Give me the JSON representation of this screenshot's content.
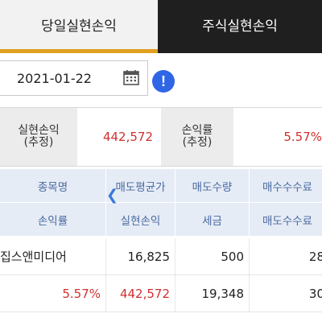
{
  "tabs": [
    {
      "label": "당일실현손익",
      "active": true
    },
    {
      "label": "주식실현손익",
      "active": false
    }
  ],
  "date_picker": {
    "value": "2021-01-22",
    "icon": "calendar-icon"
  },
  "info_button": {
    "label": "!",
    "icon": "info-icon"
  },
  "summary": {
    "realized_pnl": {
      "label": "실현손익\n(추정)",
      "value": "442,572"
    },
    "return_rate": {
      "label": "손익률\n(추정)",
      "value": "5.57%"
    }
  },
  "table": {
    "header_row1": [
      "종목명",
      "매도평균가",
      "매도수량",
      "매수수수료"
    ],
    "header_row2": [
      "손익률",
      "실현손익",
      "세금",
      "매도수수료"
    ],
    "rows": [
      {
        "line1": [
          "집스앤미디어",
          "16,825",
          "500",
          "28"
        ],
        "line2": [
          "5.57%",
          "442,572",
          "19,348",
          "30"
        ]
      }
    ]
  },
  "colors": {
    "accent": "#e0a020",
    "tab_dark": "#1f1f1f",
    "profit_red": "#d03030",
    "header_blue": "#e6ecf6",
    "info_blue": "#2f66e6"
  }
}
